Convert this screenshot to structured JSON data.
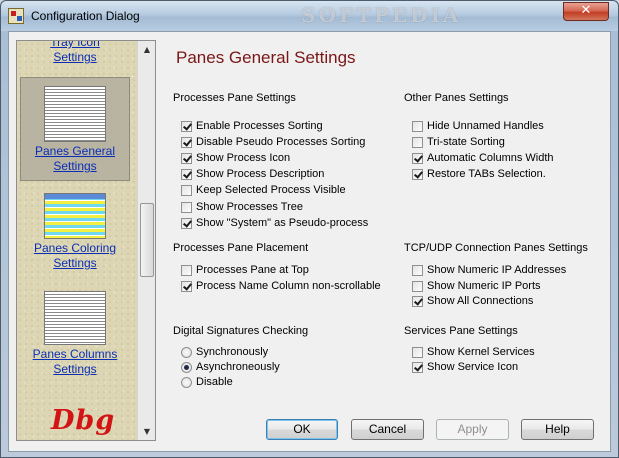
{
  "window": {
    "title": "Configuration Dialog",
    "watermark": "SOFTPEDIA",
    "close_glyph": "✕"
  },
  "sidebar": {
    "items": [
      {
        "label_line1": "Tray Icon",
        "label_line2": "Settings"
      },
      {
        "label_line1": "Panes General",
        "label_line2": "Settings",
        "selected": true
      },
      {
        "label_line1": "Panes Coloring",
        "label_line2": "Settings"
      },
      {
        "label_line1": "Panes Columns",
        "label_line2": "Settings"
      }
    ],
    "logo_text": "Dbg",
    "scroll_up": "▲",
    "scroll_down": "▼"
  },
  "page": {
    "heading": "Panes General Settings"
  },
  "processes_pane": {
    "title": "Processes Pane Settings",
    "options": [
      {
        "label": "Enable Processes Sorting",
        "checked": true
      },
      {
        "label": "Disable Pseudo Processes Sorting",
        "checked": true
      },
      {
        "label": "Show Process Icon",
        "checked": true
      },
      {
        "label": "Show Process Description",
        "checked": true
      },
      {
        "label": "Keep Selected Process Visible",
        "checked": false
      },
      {
        "label": "Show Processes Tree",
        "checked": false
      },
      {
        "label": "Show \"System\" as Pseudo-process",
        "checked": true
      }
    ]
  },
  "other_panes": {
    "title": "Other Panes Settings",
    "options": [
      {
        "label": "Hide Unnamed Handles",
        "checked": false
      },
      {
        "label": "Tri-state Sorting",
        "checked": false
      },
      {
        "label": "Automatic Columns Width",
        "checked": true
      },
      {
        "label": "Restore TABs Selection.",
        "checked": true
      }
    ]
  },
  "placement": {
    "title": "Processes Pane Placement",
    "options": [
      {
        "label": "Processes Pane at Top",
        "checked": false
      },
      {
        "label": "Process Name Column non-scrollable",
        "checked": true
      }
    ]
  },
  "tcpudp": {
    "title": "TCP/UDP Connection Panes Settings",
    "options": [
      {
        "label": "Show Numeric IP Addresses",
        "checked": false
      },
      {
        "label": "Show Numeric IP Ports",
        "checked": false
      },
      {
        "label": "Show All Connections",
        "checked": true
      }
    ]
  },
  "signatures": {
    "title": "Digital Signatures Checking",
    "options": [
      {
        "label": "Synchronously",
        "selected": false
      },
      {
        "label": "Asynchroneously",
        "selected": true
      },
      {
        "label": "Disable",
        "selected": false
      }
    ]
  },
  "services": {
    "title": "Services Pane Settings",
    "options": [
      {
        "label": "Show Kernel Services",
        "checked": false
      },
      {
        "label": "Show Service Icon",
        "checked": true
      }
    ]
  },
  "buttons": {
    "ok": "OK",
    "cancel": "Cancel",
    "apply": "Apply",
    "help": "Help"
  }
}
